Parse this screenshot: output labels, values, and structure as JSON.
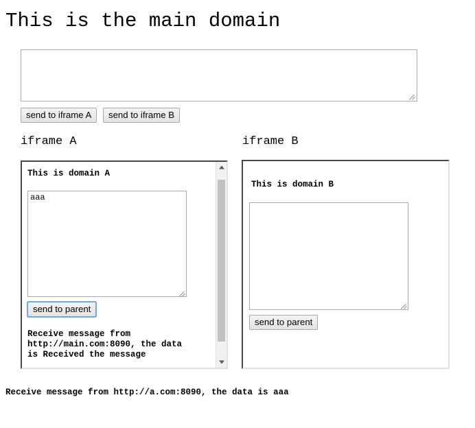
{
  "page": {
    "title": "This is the main domain",
    "bottom_message": "Receive message from http://a.com:8090, the data is aaa"
  },
  "main_form": {
    "textarea_value": "",
    "textarea_placeholder": "",
    "buttons": [
      {
        "id": "send-to-iframe-a",
        "label": "send to iframe A"
      },
      {
        "id": "send-to-iframe-b",
        "label": "send to iframe B"
      }
    ]
  },
  "frames": [
    {
      "heading": "iframe A",
      "domain_title": "This is domain A",
      "textarea_value": "aaa",
      "button_label": "send to parent",
      "button_focused": true,
      "message_log": "Receive message from http://main.com:8090, the data is Received the message",
      "has_scrollbar": true
    },
    {
      "heading": "iframe B",
      "domain_title": "This is domain B",
      "textarea_value": "",
      "button_label": "send to parent",
      "button_focused": false,
      "message_log": "",
      "has_scrollbar": false
    }
  ],
  "colors": {
    "page_background": "#ffffff",
    "text": "#000000",
    "frame_border": "#9b9b9b",
    "input_border": "#a9a9a9",
    "button_border": "#a8a8a8",
    "button_face": "#e8e8e8",
    "focus_ring": "#6fa8e6",
    "scrollbar_track": "#f1f1f1",
    "scrollbar_thumb": "#c1c1c1",
    "scrollbar_arrow": "#5a5a5a"
  }
}
